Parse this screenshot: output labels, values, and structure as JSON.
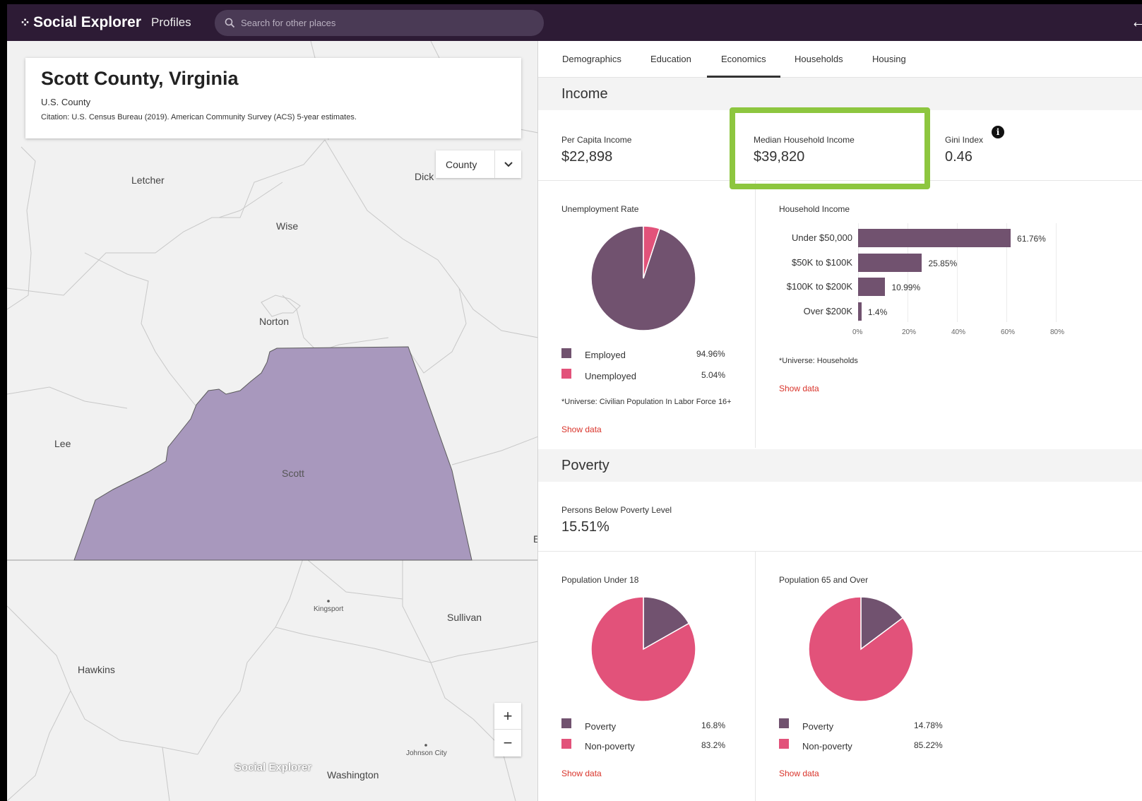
{
  "header": {
    "brand": "Social Explorer",
    "product": "Profiles",
    "search_placeholder": "Search for other places"
  },
  "place": {
    "title": "Scott County, Virginia",
    "type": "U.S. County",
    "citation": "Citation: U.S. Census Bureau (2019). American Community Survey (ACS) 5-year estimates."
  },
  "map": {
    "level_select": "County",
    "labels": {
      "letcher": "Letcher",
      "dick": "Dick",
      "wise": "Wise",
      "norton": "Norton",
      "lee": "Lee",
      "scott": "Scott",
      "kingsport": "Kingsport",
      "sullivan": "Sullivan",
      "hawkins": "Hawkins",
      "johnson_city": "Johnson City",
      "washington": "Washington",
      "edge_e": "E"
    },
    "zoom_in": "+",
    "zoom_out": "−",
    "watermark": "Social Explorer",
    "highlight_color": "#a898bd"
  },
  "tabs": [
    "Demographics",
    "Education",
    "Economics",
    "Households",
    "Housing"
  ],
  "active_tab": "Economics",
  "income": {
    "heading": "Income",
    "per_capita_label": "Per Capita Income",
    "per_capita_value": "$22,898",
    "median_label": "Median Household Income",
    "median_value": "$39,820",
    "gini_label": "Gini Index",
    "gini_value": "0.46"
  },
  "unemployment": {
    "title": "Unemployment Rate",
    "legend": [
      {
        "label": "Employed",
        "pct": "94.96%",
        "value": 94.96,
        "color": "#71526f"
      },
      {
        "label": "Unemployed",
        "pct": "5.04%",
        "value": 5.04,
        "color": "#e2527a"
      }
    ],
    "note": "*Universe: Civilian Population In Labor Force 16+",
    "show_data": "Show data"
  },
  "household_income": {
    "title": "Household Income",
    "note": "*Universe: Households",
    "show_data": "Show data"
  },
  "chart_data": {
    "type": "bar",
    "orientation": "horizontal",
    "title": "Household Income",
    "categories": [
      "Under $50,000",
      "$50K to $100K",
      "$100K to $200K",
      "Over $200K"
    ],
    "values": [
      61.76,
      25.85,
      10.99,
      1.4
    ],
    "value_labels": [
      "61.76%",
      "25.85%",
      "10.99%",
      "1.4%"
    ],
    "xlim": [
      0,
      80
    ],
    "xticks": [
      "0%",
      "20%",
      "40%",
      "60%",
      "80%"
    ],
    "color": "#71526f"
  },
  "poverty": {
    "heading": "Poverty",
    "persons_label": "Persons Below Poverty Level",
    "persons_value": "15.51%",
    "under18": {
      "title": "Population Under 18",
      "legend": [
        {
          "label": "Poverty",
          "pct": "16.8%",
          "value": 16.8,
          "color": "#71526f"
        },
        {
          "label": "Non-poverty",
          "pct": "83.2%",
          "value": 83.2,
          "color": "#e2527a"
        }
      ],
      "show_data": "Show data"
    },
    "over65": {
      "title": "Population 65 and Over",
      "legend": [
        {
          "label": "Poverty",
          "pct": "14.78%",
          "value": 14.78,
          "color": "#71526f"
        },
        {
          "label": "Non-poverty",
          "pct": "85.22%",
          "value": 85.22,
          "color": "#e2527a"
        }
      ],
      "show_data": "Show data"
    }
  }
}
